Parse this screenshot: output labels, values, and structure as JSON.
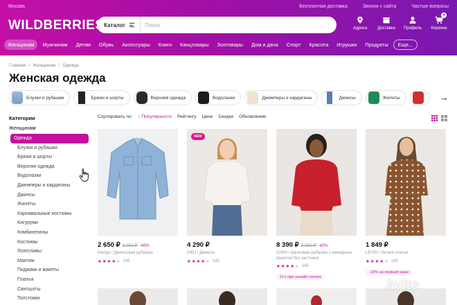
{
  "header": {
    "city": "Москва",
    "top_links": [
      "Бесплатная доставка",
      "Звонок с сайта",
      "Частые вопросы"
    ],
    "logo": "WILDBERRIES",
    "catalog_label": "Каталог",
    "search_placeholder": "Поиск",
    "icons": [
      {
        "label": "Адреса",
        "icon": "map-pin-icon"
      },
      {
        "label": "Доставка",
        "icon": "box-icon"
      },
      {
        "label": "Профиль",
        "icon": "user-icon"
      },
      {
        "label": "Корзина",
        "icon": "cart-icon",
        "badge": "4"
      }
    ],
    "nav": [
      "Женщинам",
      "Мужчинам",
      "Детям",
      "Обувь",
      "Аксессуары",
      "Книги",
      "Канцтовары",
      "Зоотовары",
      "Дом и дача",
      "Спорт",
      "Красота",
      "Игрушки",
      "Продукты",
      "Еще..."
    ],
    "brand_colors": {
      "start": "#c40fa7",
      "end": "#7a18b0"
    }
  },
  "breadcrumb": [
    "Главная",
    "Женщинам",
    "Одежда"
  ],
  "page_title": "Женская одежда",
  "chips": [
    "Блузки и рубашки",
    "Брюки и шорты",
    "Верхняя одежда",
    "Водолазки",
    "Джемперы и кардиганы",
    "Джинсы",
    "Жилеты"
  ],
  "sidebar": {
    "heading": "Категории",
    "parent": "Женщинам",
    "items": [
      "Одежда",
      "Блузки и рубашки",
      "Брюки и шорты",
      "Верхняя одежда",
      "Водолазки",
      "Джемперы и кардиганы",
      "Джинсы",
      "Жилеты",
      "Карнавальные костюмы",
      "Кигуруми",
      "Комбинезоны",
      "Костюмы",
      "Лонгсливы",
      "Мантии",
      "Пиджаки и жакеты",
      "Платья",
      "Свитшоты",
      "Толстовки"
    ],
    "active_index": 0
  },
  "sort": {
    "label": "Сортировать по:",
    "options": [
      "Популярности",
      "Рейтингу",
      "Цене",
      "Скидке",
      "Обновлению"
    ],
    "active_index": 0
  },
  "products": [
    {
      "price": "2 650 ₽",
      "old_price": "9 950 ₽",
      "discount": "-40%",
      "brand": "Mango / Джинсовая рубашка",
      "rating": 4,
      "reviews": "145",
      "promo": "",
      "badge": ""
    },
    {
      "price": "4 290 ₽",
      "old_price": "",
      "discount": "",
      "brand": "DIBJ / Джинсы",
      "rating": 4,
      "reviews": "145",
      "promo": "",
      "badge": "NEW"
    },
    {
      "price": "8 390 ₽",
      "old_price": "9 990 ₽",
      "discount": "-40%",
      "brand": "ZARA / Шелковая рубашка с невидным принтом без застежек",
      "rating": 4,
      "reviews": "145",
      "promo": "2+1 при онлайн оплате",
      "badge": ""
    },
    {
      "price": "1 849 ₽",
      "old_price": "",
      "discount": "",
      "brand": "LEVIS / Легкие платья",
      "rating": 4,
      "reviews": "145",
      "promo": "-10% на первый заказ",
      "badge": ""
    }
  ],
  "colors": {
    "accent": "#c2119f"
  },
  "watermark": "Avito"
}
